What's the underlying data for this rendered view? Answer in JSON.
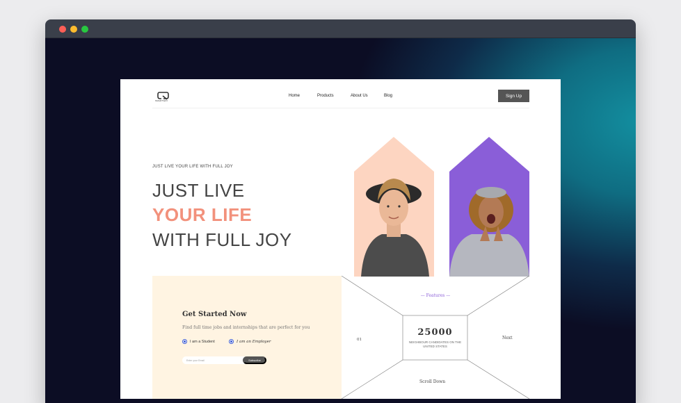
{
  "window": {
    "dot_colors": [
      "#ff5f57",
      "#febc2e",
      "#28c840"
    ]
  },
  "nav": {
    "logo_text": "SMARTWAY",
    "links": [
      "Home",
      "Products",
      "About Us",
      "Blog"
    ],
    "signup_label": "Sign Up"
  },
  "hero": {
    "eyebrow": "JUST LIVE YOUR LIFE WITH FULL JOY",
    "line1": "JUST LIVE",
    "line2": "YOUR LIFE",
    "line3": "WITH FULL JOY",
    "card_colors": [
      "#fdd5c1",
      "#8a5ed8"
    ]
  },
  "get_started": {
    "title": "Get Started Now",
    "subtitle": "Find full time jobs and internships that are perfect for you",
    "options": [
      "I am a Student",
      "I am an Employer"
    ],
    "email_placeholder": "Enter your Email",
    "subscribe_label": "Subscribe"
  },
  "features": {
    "label": "— Features —",
    "number": "25000",
    "caption": "NEIGHBOUR CANDIDATES ON THE UNITED STATES",
    "slide_index": "01",
    "next_label": "Next",
    "scroll_label": "Scroll Down"
  },
  "colors": {
    "accent": "#f2917c",
    "purple": "#8a5ed8",
    "cream": "#fff4e2"
  }
}
